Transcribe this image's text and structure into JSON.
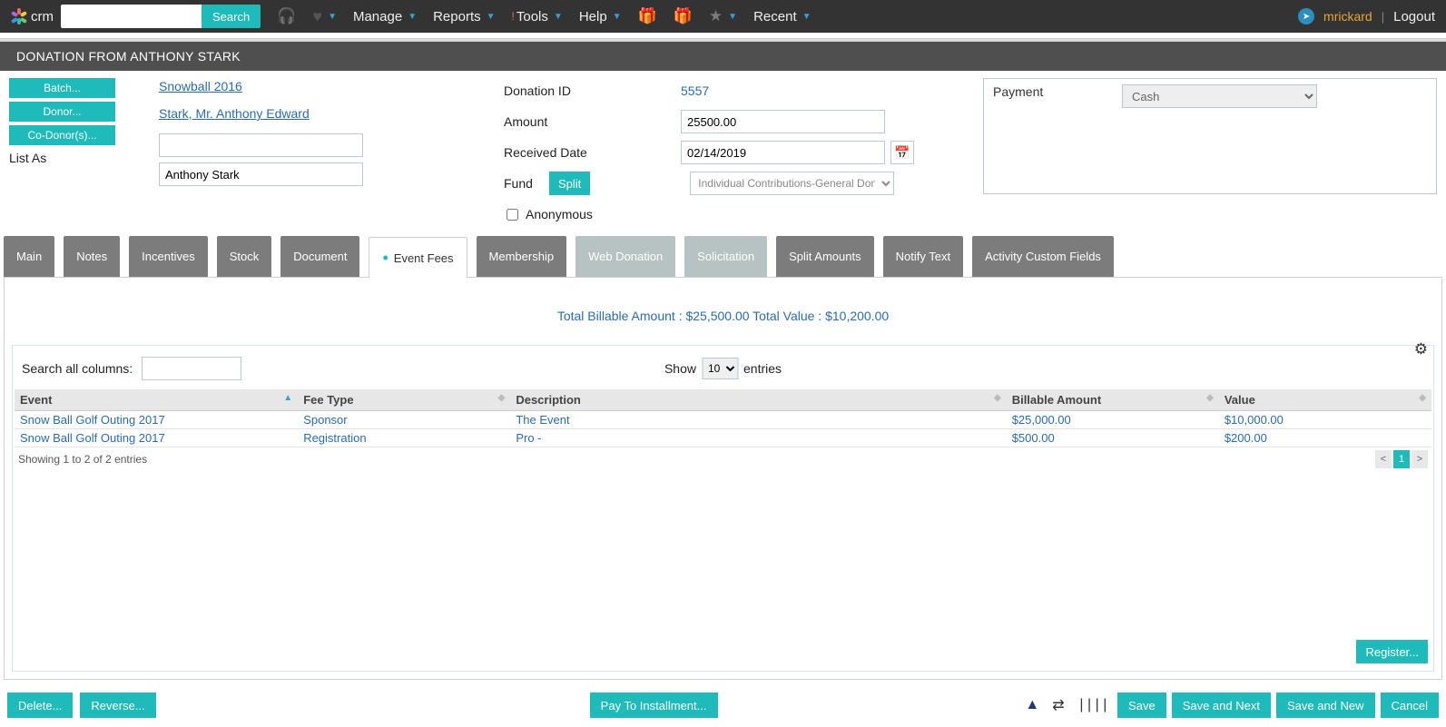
{
  "brand": {
    "text": "crm"
  },
  "nav": {
    "search_label": "Search",
    "manage": "Manage",
    "reports": "Reports",
    "tools": "Tools",
    "help": "Help",
    "recent": "Recent"
  },
  "user": {
    "name": "mrickard",
    "logout": "Logout"
  },
  "page_title": "DONATION FROM ANTHONY STARK",
  "leftbuttons": {
    "batch": "Batch...",
    "donor": "Donor...",
    "codonors": "Co-Donor(s)..."
  },
  "listas_label": "List As",
  "donor": {
    "batch_link": "Snowball 2016",
    "donor_link": "Stark, Mr. Anthony Edward",
    "listas_value": "Anthony Stark"
  },
  "fields": {
    "donation_id_label": "Donation ID",
    "donation_id": "5557",
    "amount_label": "Amount",
    "amount": "25500.00",
    "received_label": "Received Date",
    "received": "02/14/2019",
    "fund_label": "Fund",
    "split_label": "Split",
    "fund_value": "Individual Contributions-General Don",
    "anon_label": "Anonymous"
  },
  "payment": {
    "label": "Payment",
    "value": "Cash"
  },
  "tabs": {
    "main": "Main",
    "notes": "Notes",
    "incentives": "Incentives",
    "stock": "Stock",
    "document": "Document",
    "eventfees": "Event Fees",
    "membership": "Membership",
    "webdonation": "Web Donation",
    "solicitation": "Solicitation",
    "splitamounts": "Split Amounts",
    "notifytext": "Notify Text",
    "activitycf": "Activity Custom Fields"
  },
  "summary": "Total Billable Amount : $25,500.00 Total Value : $10,200.00",
  "dt": {
    "search_label": "Search all columns:",
    "show": "Show",
    "page_size": "10",
    "entries": "entries",
    "headers": {
      "event": "Event",
      "feetype": "Fee Type",
      "desc": "Description",
      "billable": "Billable Amount",
      "value": "Value"
    },
    "rows": [
      {
        "event": "Snow Ball Golf Outing 2017",
        "feetype": "Sponsor",
        "desc": "The Event",
        "billable": "$25,000.00",
        "value": "$10,000.00"
      },
      {
        "event": "Snow Ball Golf Outing 2017",
        "feetype": "Registration",
        "desc": "Pro -",
        "billable": "$500.00",
        "value": "$200.00"
      }
    ],
    "showing": "Showing 1 to 2 of 2 entries",
    "page": "1",
    "register": "Register..."
  },
  "footer": {
    "delete": "Delete...",
    "reverse": "Reverse...",
    "paytoinstall": "Pay To Installment...",
    "save": "Save",
    "savenext": "Save and Next",
    "savenew": "Save and New",
    "cancel": "Cancel"
  }
}
